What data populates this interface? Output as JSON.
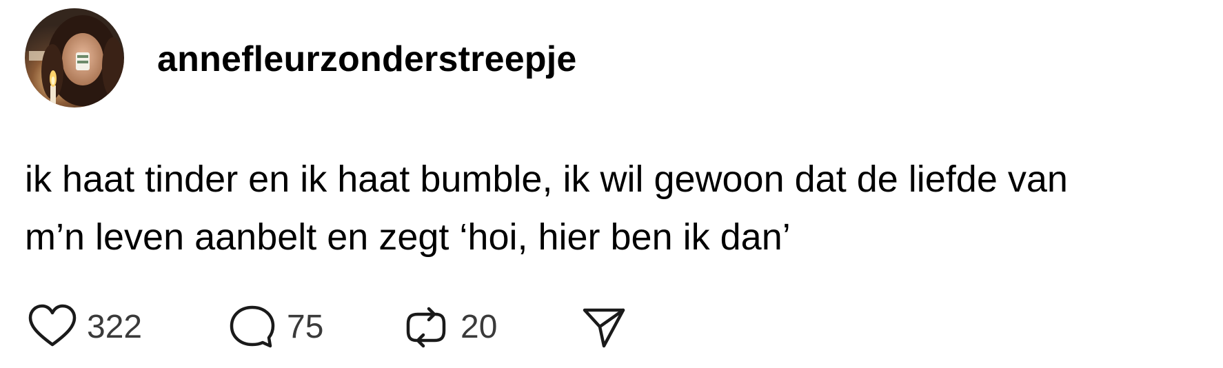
{
  "post": {
    "username": "annefleurzonderstreepje",
    "text_lines": [
      "ik haat tinder en ik haat bumble, ik wil gewoon dat de liefde van",
      "m’n leven aanbelt en zegt ‘hoi, hier ben ik dan’"
    ],
    "actions": {
      "like_count": "322",
      "reply_count": "75",
      "repost_count": "20"
    },
    "icons": {
      "like": "heart-icon",
      "reply": "speech-bubble-icon",
      "repost": "repost-arrows-icon",
      "share": "send-icon",
      "avatar": "profile-photo"
    },
    "colors": {
      "text": "#000000",
      "count": "#3a3a3a",
      "icon_stroke": "#1a1a1a"
    }
  }
}
